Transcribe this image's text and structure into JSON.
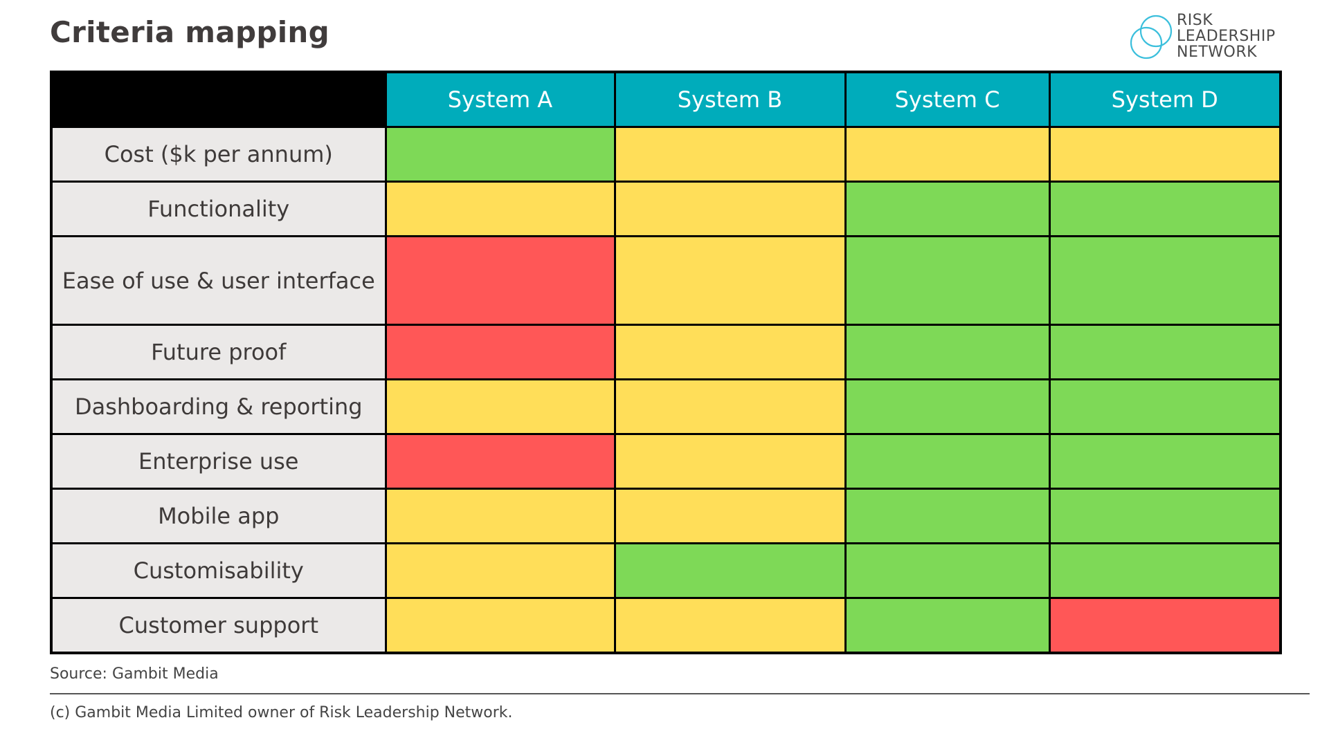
{
  "title": "Criteria mapping",
  "logo": {
    "icon": "interlocking-rings-icon",
    "lines": [
      "RISK",
      "LEADERSHIP",
      "NETWORK"
    ],
    "color": "#3bbfdc"
  },
  "palette": {
    "green": "#7ed957",
    "yellow": "#ffde59",
    "red": "#ff5757",
    "header": "#00acbb"
  },
  "table": {
    "columns": [
      "System A",
      "System B",
      "System C",
      "System D"
    ],
    "rows": [
      {
        "criterion": "Cost ($k per annum)",
        "ratings": [
          "green",
          "yellow",
          "yellow",
          "yellow"
        ]
      },
      {
        "criterion": "Functionality",
        "ratings": [
          "yellow",
          "yellow",
          "green",
          "green"
        ]
      },
      {
        "criterion": "Ease of use & user interface",
        "ratings": [
          "red",
          "yellow",
          "green",
          "green"
        ]
      },
      {
        "criterion": "Future proof",
        "ratings": [
          "red",
          "yellow",
          "green",
          "green"
        ]
      },
      {
        "criterion": "Dashboarding & reporting",
        "ratings": [
          "yellow",
          "yellow",
          "green",
          "green"
        ]
      },
      {
        "criterion": "Enterprise use",
        "ratings": [
          "red",
          "yellow",
          "green",
          "green"
        ]
      },
      {
        "criterion": "Mobile app",
        "ratings": [
          "yellow",
          "yellow",
          "green",
          "green"
        ]
      },
      {
        "criterion": "Customisability",
        "ratings": [
          "yellow",
          "green",
          "green",
          "green"
        ]
      },
      {
        "criterion": "Customer support",
        "ratings": [
          "yellow",
          "yellow",
          "green",
          "red"
        ]
      }
    ]
  },
  "source": "Source: Gambit Media",
  "copyright": "(c) Gambit Media Limited owner of Risk Leadership Network."
}
